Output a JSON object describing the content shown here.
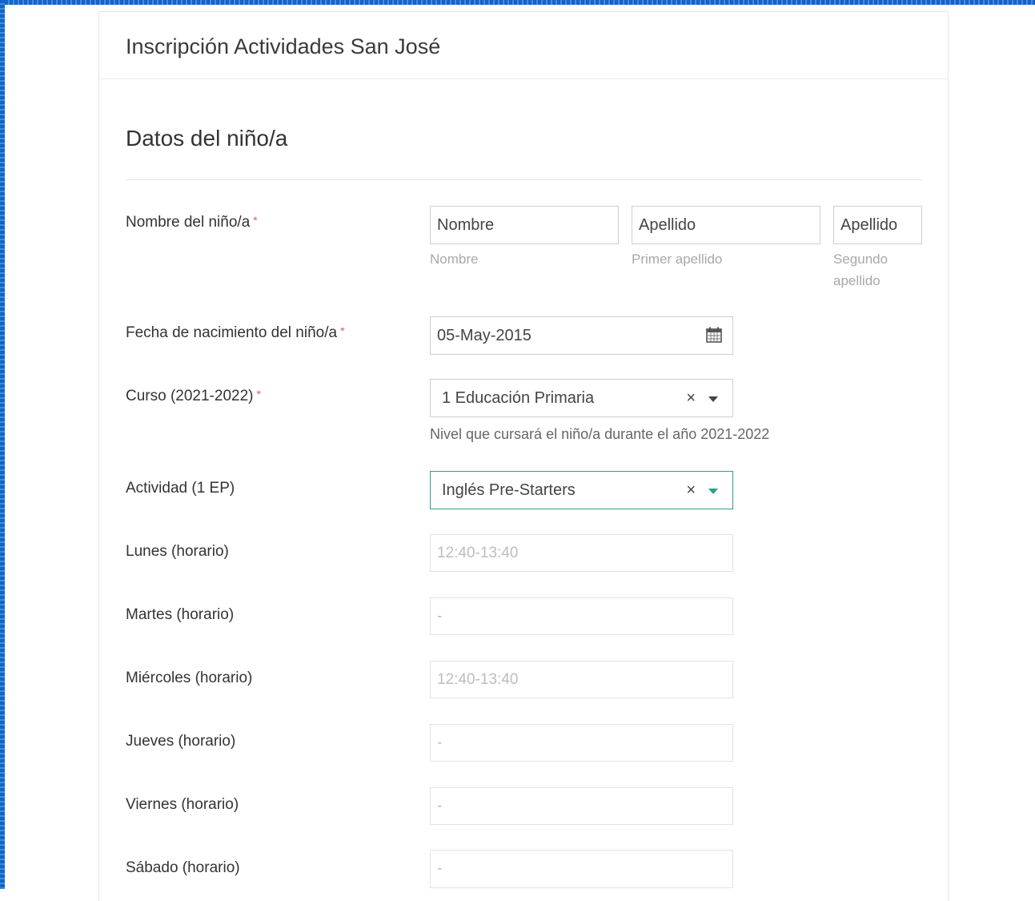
{
  "form": {
    "title": "Inscripción Actividades San José"
  },
  "section": {
    "title": "Datos del niño/a"
  },
  "fields": {
    "nombre": {
      "label": "Nombre del niño/a",
      "required_mark": "*",
      "first_name": {
        "value": "Nombre",
        "hint": "Nombre"
      },
      "last_name_1": {
        "value": "Apellido",
        "hint": "Primer apellido"
      },
      "last_name_2": {
        "value": "Apellido",
        "hint_line1": "Segundo",
        "hint_line2": "apellido"
      }
    },
    "fecha": {
      "label": "Fecha de nacimiento del niño/a",
      "required_mark": "*",
      "value": "05-May-2015",
      "icon": "calendar-icon"
    },
    "curso": {
      "label": "Curso (2021-2022)",
      "required_mark": "*",
      "value": "1 Educación Primaria",
      "help": "Nivel que cursará el niño/a durante el año 2021-2022",
      "clear": "×"
    },
    "actividad": {
      "label": "Actividad (1 EP)",
      "value": "Inglés Pre-Starters",
      "clear": "×",
      "accent": "#2e9e8a"
    },
    "lunes": {
      "label": "Lunes (horario)",
      "value": "12:40-13:40"
    },
    "martes": {
      "label": "Martes (horario)",
      "value": "-"
    },
    "miercoles": {
      "label": "Miércoles (horario)",
      "value": "12:40-13:40"
    },
    "jueves": {
      "label": "Jueves (horario)",
      "value": "-"
    },
    "viernes": {
      "label": "Viernes (horario)",
      "value": "-"
    },
    "sabado": {
      "label": "Sábado (horario)",
      "value": "-"
    }
  },
  "colors": {
    "frame": "#1565c0",
    "required": "#e05a5a",
    "focus": "#2e9e8a"
  }
}
